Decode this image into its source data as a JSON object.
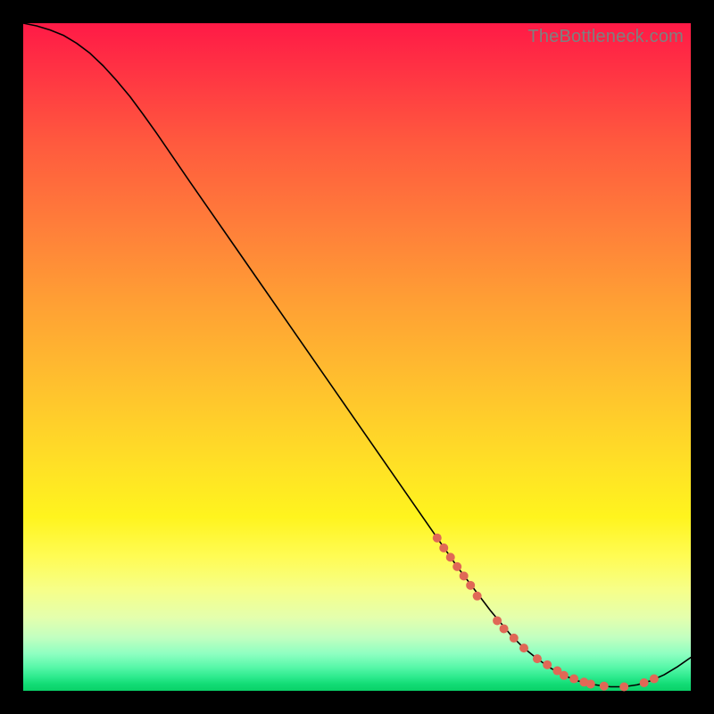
{
  "watermark": "TheBottleneck.com",
  "chart_data": {
    "type": "line",
    "title": "",
    "xlabel": "",
    "ylabel": "",
    "xlim": [
      0,
      100
    ],
    "ylim": [
      0,
      100
    ],
    "grid": false,
    "legend": false,
    "series": [
      {
        "name": "curve",
        "x": [
          0,
          2,
          4,
          6,
          8,
          10,
          12,
          14,
          16,
          18,
          20,
          25,
          30,
          35,
          40,
          45,
          50,
          55,
          60,
          65,
          70,
          73,
          75,
          77,
          79,
          81,
          83,
          85,
          87,
          88,
          90,
          92,
          94,
          96,
          98,
          100
        ],
        "y": [
          100,
          99.6,
          99.0,
          98.2,
          97.0,
          95.5,
          93.6,
          91.4,
          89.0,
          86.3,
          83.5,
          76.2,
          69.0,
          61.8,
          54.6,
          47.4,
          40.2,
          33.0,
          25.8,
          18.6,
          12.0,
          8.4,
          6.4,
          4.8,
          3.4,
          2.3,
          1.5,
          1.0,
          0.7,
          0.6,
          0.6,
          0.9,
          1.5,
          2.4,
          3.6,
          5.0
        ]
      }
    ],
    "scatter": {
      "name": "points",
      "x": [
        62,
        63,
        64,
        65,
        66,
        67,
        68,
        71,
        72,
        73.5,
        75,
        77,
        78.5,
        80,
        81,
        82.5,
        84,
        85,
        87,
        90,
        93,
        94.5
      ],
      "y": [
        22.9,
        21.4,
        20.0,
        18.6,
        17.2,
        15.8,
        14.2,
        10.5,
        9.3,
        7.9,
        6.4,
        4.8,
        3.9,
        3.0,
        2.3,
        1.8,
        1.3,
        1.0,
        0.7,
        0.6,
        1.2,
        1.8
      ],
      "color": "#e06856",
      "radius_px": 5
    },
    "background_gradient": {
      "direction": "vertical",
      "stops": [
        {
          "pos": 0.0,
          "color": "#ff1a46"
        },
        {
          "pos": 0.3,
          "color": "#ff7d3a"
        },
        {
          "pos": 0.66,
          "color": "#ffe026"
        },
        {
          "pos": 0.85,
          "color": "#f6ff8a"
        },
        {
          "pos": 0.96,
          "color": "#56f7a8"
        },
        {
          "pos": 1.0,
          "color": "#0ad168"
        }
      ]
    }
  }
}
